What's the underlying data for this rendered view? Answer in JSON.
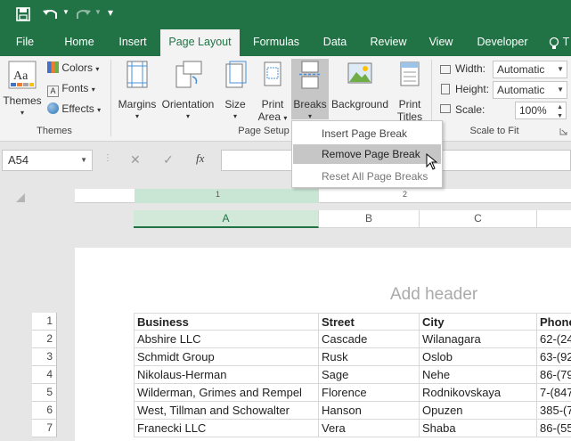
{
  "qat": {
    "customize": "▾"
  },
  "tabs": [
    "File",
    "Home",
    "Insert",
    "Page Layout",
    "Formulas",
    "Data",
    "Review",
    "View",
    "Developer",
    "T"
  ],
  "ribbon": {
    "themes_group": {
      "themes": "Themes",
      "colors": "Colors",
      "fonts": "Fonts",
      "effects": "Effects",
      "label": "Themes"
    },
    "page_setup": {
      "margins": "Margins",
      "orientation": "Orientation",
      "size": "Size",
      "print_area_1": "Print",
      "print_area_2": "Area",
      "breaks": "Breaks",
      "background": "Background",
      "print_titles_1": "Print",
      "print_titles_2": "Titles",
      "label": "Page Setup"
    },
    "scale": {
      "width_label": "Width:",
      "width_value": "Automatic",
      "height_label": "Height:",
      "height_value": "Automatic",
      "scale_label": "Scale:",
      "scale_value": "100%",
      "label": "Scale to Fit"
    }
  },
  "formula_bar": {
    "name_box": "A54",
    "fx": "fx",
    "cancel": "✕",
    "enter": "✓"
  },
  "breaks_menu": [
    "Insert Page Break",
    "Remove Page Break",
    "Reset All Page Breaks"
  ],
  "ruler": {
    "marks": [
      "1",
      "2"
    ]
  },
  "columns": [
    "A",
    "B",
    "C"
  ],
  "page": {
    "header_placeholder": "Add header"
  },
  "table": {
    "headers": [
      "Business",
      "Street",
      "City",
      "Phone"
    ],
    "rows": [
      [
        "Abshire LLC",
        "Cascade",
        "Wilanagara",
        "62-(24"
      ],
      [
        "Schmidt Group",
        "Rusk",
        "Oslob",
        "63-(92"
      ],
      [
        "Nikolaus-Herman",
        "Sage",
        "Nehe",
        "86-(79"
      ],
      [
        "Wilderman, Grimes and Rempel",
        "Florence",
        "Rodnikovskaya",
        "7-(847"
      ],
      [
        "West, Tillman and Schowalter",
        "Hanson",
        "Opuzen",
        "385-(7"
      ],
      [
        "Franecki LLC",
        "Vera",
        "Shaba",
        "86-(55"
      ]
    ],
    "row_numbers": [
      "1",
      "2",
      "3",
      "4",
      "5",
      "6",
      "7"
    ]
  }
}
